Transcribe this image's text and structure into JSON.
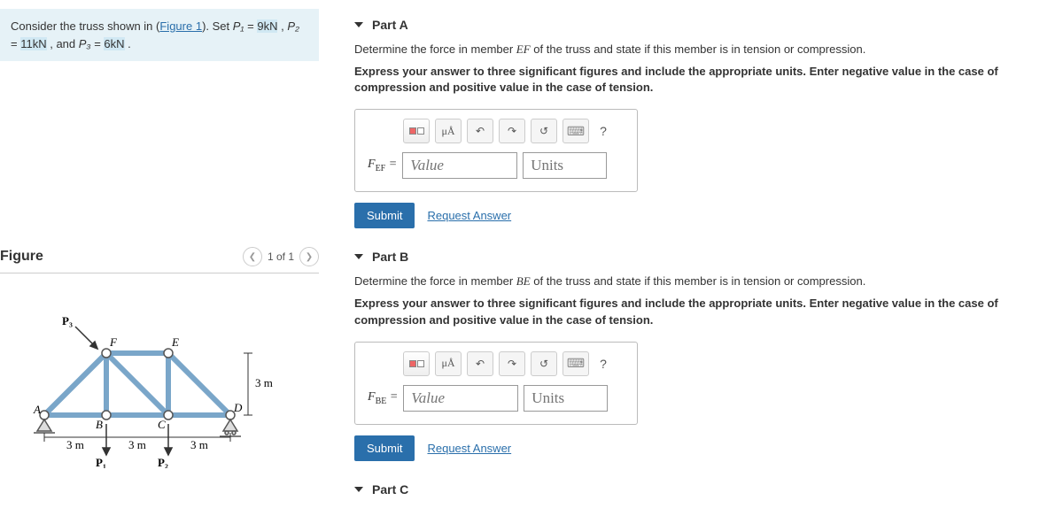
{
  "problem": {
    "prefix": "Consider the truss shown in (",
    "figure_link": "Figure 1",
    "after_link": "). Set ",
    "p1_var": "P₁",
    "p1_eq": " = ",
    "p1_val": "9kN",
    "sep1": " , ",
    "p2_var": "P₂",
    "p2_eq": " = ",
    "p2_val": "11kN",
    "sep2": " , and ",
    "p3_var": "P₃",
    "p3_eq": " = ",
    "p3_val": "6kN",
    "tail": " ."
  },
  "figure": {
    "title": "Figure",
    "counter": "1 of 1",
    "labels": {
      "P1": "P₁",
      "P2": "P₂",
      "P3": "P₃",
      "A": "A",
      "B": "B",
      "C": "C",
      "D": "D",
      "E": "E",
      "F": "F",
      "d3m": "3 m"
    }
  },
  "toolbar": {
    "ua_label": "μÅ"
  },
  "partA": {
    "header": "Part A",
    "prompt_before": "Determine the force in member ",
    "member": "EF",
    "prompt_after": " of the truss and state if this member is in tension or compression.",
    "instructions": "Express your answer to three significant figures and include the appropriate units. Enter negative value in the case of compression and positive value in the case of tension.",
    "var_main": "F",
    "var_sub": "EF",
    "value_ph": "Value",
    "units_ph": "Units",
    "submit": "Submit",
    "request": "Request Answer"
  },
  "partB": {
    "header": "Part B",
    "prompt_before": "Determine the force in member ",
    "member": "BE",
    "prompt_after": " of the truss and state if this member is in tension or compression.",
    "instructions": "Express your answer to three significant figures and include the appropriate units. Enter negative value in the case of compression and positive value in the case of tension.",
    "var_main": "F",
    "var_sub": "BE",
    "value_ph": "Value",
    "units_ph": "Units",
    "submit": "Submit",
    "request": "Request Answer"
  },
  "partC": {
    "header": "Part C"
  }
}
